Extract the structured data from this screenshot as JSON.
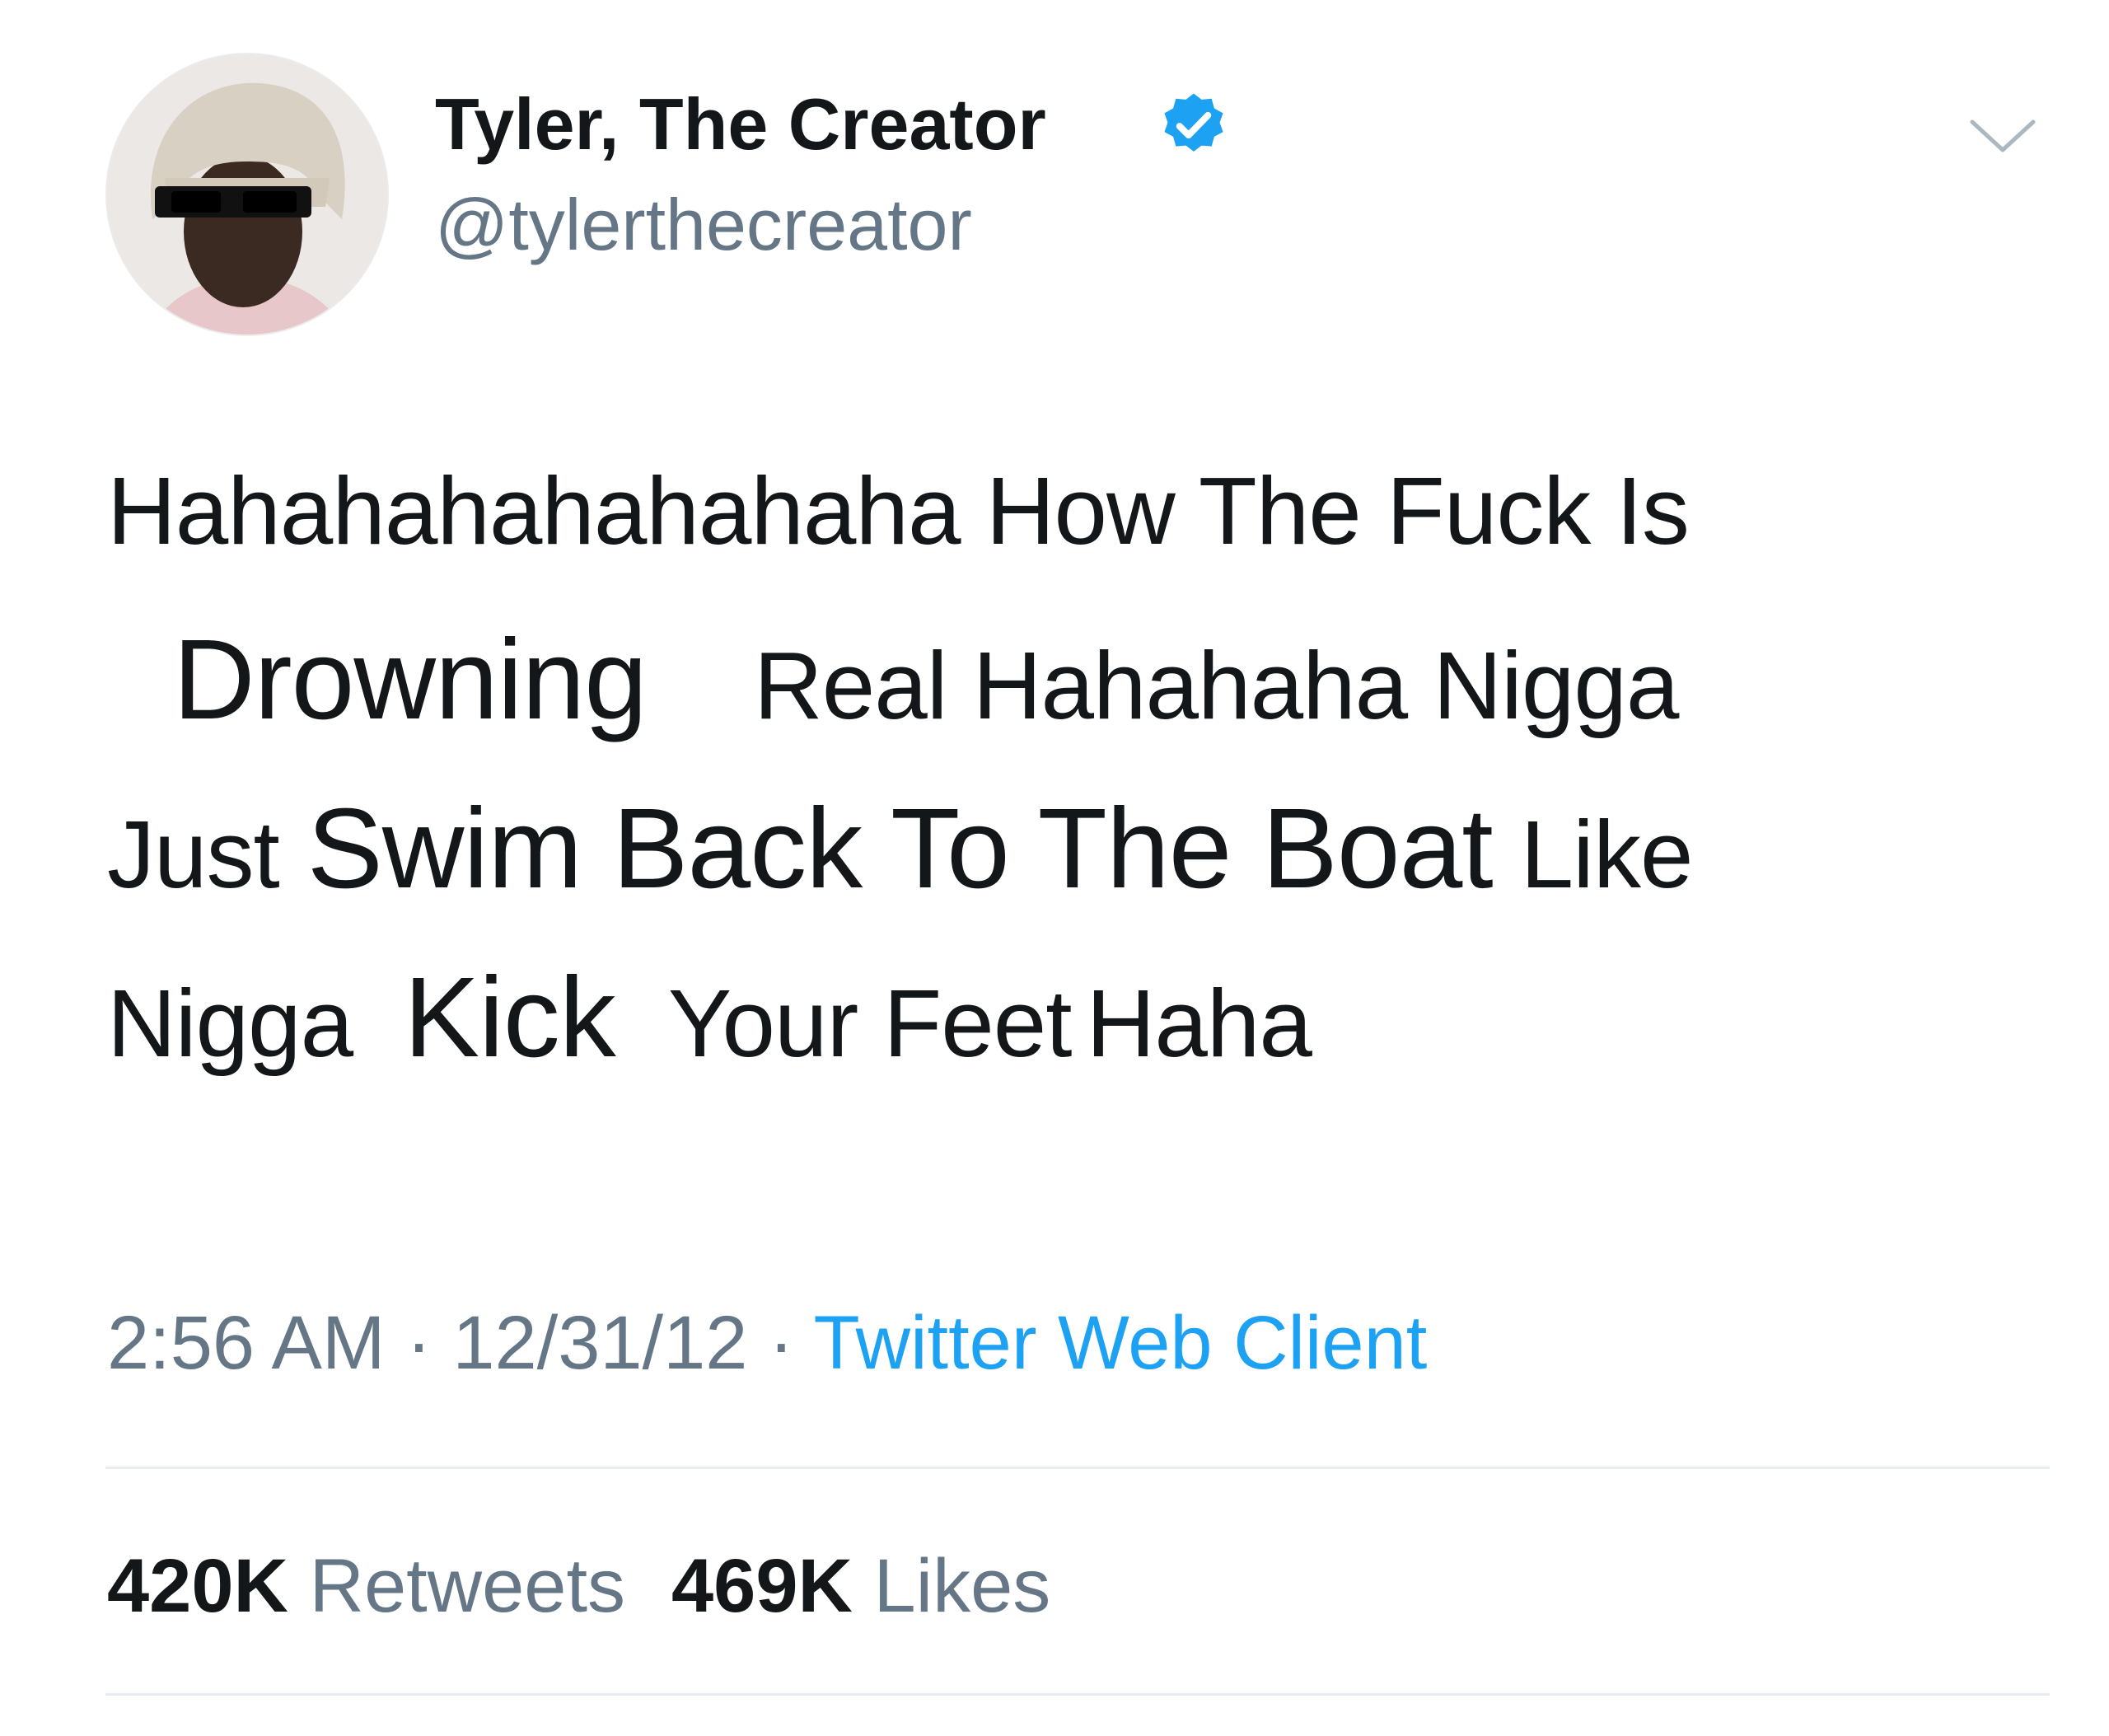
{
  "author": {
    "display_name": "Tyler, The Creator",
    "handle": "@tylerthecreator",
    "verified": true,
    "avatar_icon": "profile-photo"
  },
  "tweet": {
    "line1": "Hahahahahahahaha How The Fuck Is",
    "line2_a": "Drowning",
    "line2_b": "Real Hahahaha Nigga",
    "line3_a": "Just",
    "line3_b": "Swim Back To The Boat",
    "line3_c": "Like",
    "line4_a": "Nigga",
    "line4_b": "Kick",
    "line4_c": "Your Feet",
    "line4_d": "Haha"
  },
  "meta": {
    "time": "2:56 AM",
    "date": "12/31/12",
    "separator": "·",
    "source": "Twitter Web Client"
  },
  "stats": {
    "retweets_count": "420K",
    "retweets_label": "Retweets",
    "likes_count": "469K",
    "likes_label": "Likes"
  },
  "colors": {
    "text": "#14171a",
    "secondary": "#657786",
    "link": "#1da1f2",
    "verified": "#1da1f2",
    "divider": "#e6ecf0"
  }
}
